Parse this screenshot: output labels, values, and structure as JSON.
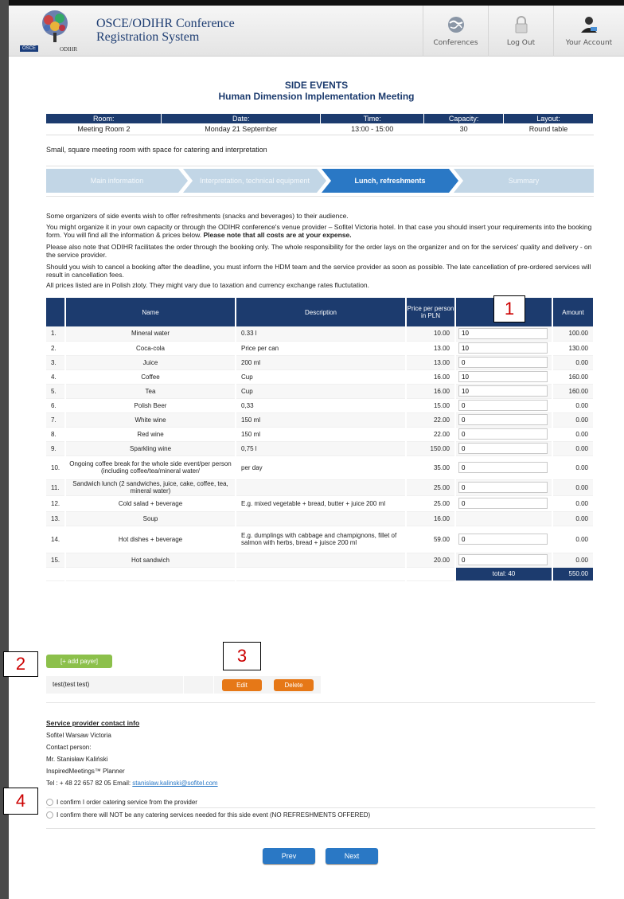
{
  "app": {
    "title_line1": "OSCE/ODIHR Conference",
    "title_line2": "Registration System",
    "logo_osce": "OSCE",
    "logo_odihr": "ODIHR"
  },
  "nav": [
    {
      "label": "Conferences",
      "icon": "globe-icon"
    },
    {
      "label": "Log Out",
      "icon": "lock-icon"
    },
    {
      "label": "Your Account",
      "icon": "user-icon"
    }
  ],
  "page": {
    "title": "SIDE EVENTS",
    "subtitle": "Human Dimension Implementation Meeting"
  },
  "info_table": {
    "headers": [
      "Room:",
      "Date:",
      "Time:",
      "Capacity:",
      "Layout:"
    ],
    "values": [
      "Meeting Room 2",
      "Monday 21 September",
      "13:00 - 15:00",
      "30",
      "Round table"
    ]
  },
  "room_description": "Small, square meeting room with space for catering and interpretation",
  "steps": [
    {
      "label": "Main information",
      "active": false
    },
    {
      "label": "Interpretation, technical equipment",
      "active": false
    },
    {
      "label": "Lunch, refreshments",
      "active": true
    },
    {
      "label": "Summary",
      "active": false
    }
  ],
  "intro": {
    "p1": "Some organizers of side events wish to offer refreshments (snacks and beverages) to their audience.",
    "p2": "You might organize it in your own capacity or through the ODIHR conference's venue provider – Sofitel Victoria hotel.  In that case you should insert your requirements into the booking form. You will find all the information & prices below.",
    "p2_bold": "Please note that all costs are at your expense.",
    "p3": "Please also note that ODIHR facilitates the order through the booking only. The whole responsibility for the order lays on the organizer and on for the services' quality and delivery - on the service provider.",
    "p4": "Should you wish to cancel a booking after the deadline, you must inform the HDM team and the service provider as soon as possible. The late cancellation of pre-ordered services will result in cancellation fees.",
    "p5": "All prices listed are in Polish zloty. They might vary due to taxation and currency exchange rates fluctutation."
  },
  "order_table": {
    "headers": {
      "num": "",
      "name": "Name",
      "desc": "Description",
      "price": "Price per person in PLN",
      "qty": "",
      "amount": "Amount"
    },
    "rows": [
      {
        "num": "1.",
        "name": "Mineral water",
        "desc": "0.33 l",
        "price": "10.00",
        "qty": "10",
        "amount": "100.00"
      },
      {
        "num": "2.",
        "name": "Coca-cola",
        "desc": "Price per can",
        "price": "13.00",
        "qty": "10",
        "amount": "130.00"
      },
      {
        "num": "3.",
        "name": "Juice",
        "desc": "200 ml",
        "price": "13.00",
        "qty": "0",
        "amount": "0.00"
      },
      {
        "num": "4.",
        "name": "Coffee",
        "desc": "Cup",
        "price": "16.00",
        "qty": "10",
        "amount": "160.00"
      },
      {
        "num": "5.",
        "name": "Tea",
        "desc": "Cup",
        "price": "16.00",
        "qty": "10",
        "amount": "160.00"
      },
      {
        "num": "6.",
        "name": "Polish Beer",
        "desc": "0,33",
        "price": "15.00",
        "qty": "0",
        "amount": "0.00"
      },
      {
        "num": "7.",
        "name": "White wine",
        "desc": "150 ml",
        "price": "22.00",
        "qty": "0",
        "amount": "0.00"
      },
      {
        "num": "8.",
        "name": "Red wine",
        "desc": "150 ml",
        "price": "22.00",
        "qty": "0",
        "amount": "0.00"
      },
      {
        "num": "9.",
        "name": "Sparkling wine",
        "desc": "0,75 l",
        "price": "150.00",
        "qty": "0",
        "amount": "0.00"
      },
      {
        "num": "10.",
        "name": "Ongoing coffee break for the whole side event/per person (including coffee/tea/mineral water/",
        "desc": "per day",
        "price": "35.00",
        "qty": "0",
        "amount": "0.00"
      },
      {
        "num": "11.",
        "name": "Sandwich lunch (2 sandwiches, juice, cake, coffee, tea, mineral water)",
        "desc": "",
        "price": "25.00",
        "qty": "0",
        "amount": "0.00"
      },
      {
        "num": "12.",
        "name": "Cold salad + beverage",
        "desc": "E.g. mixed vegetable + bread, butter + juice 200 ml",
        "price": "25.00",
        "qty": "0",
        "amount": "0.00"
      },
      {
        "num": "13.",
        "name": "Soup",
        "desc": "",
        "price": "16.00",
        "qty": "",
        "amount": "0.00"
      },
      {
        "num": "14.",
        "name": "Hot dishes + beverage",
        "desc": "E.g. dumplings with cabbage and champignons, fillet of salmon with herbs, bread + juisce 200 ml",
        "price": "59.00",
        "qty": "0",
        "amount": "0.00"
      },
      {
        "num": "15.",
        "name": "Hot sandwich",
        "desc": "",
        "price": "20.00",
        "qty": "0",
        "amount": "0.00"
      }
    ],
    "total_label": "total: 40",
    "total_amount": "550.00"
  },
  "payers": {
    "add_label": "[+ add payer]",
    "rows": [
      {
        "name": "test(test test)",
        "edit": "Edit",
        "delete": "Delete"
      }
    ]
  },
  "service_provider": {
    "title": "Service provider contact info",
    "lines": [
      "Sofitel Warsaw Victoria",
      "Contact person:",
      "Mr. Stanisław Kaliński",
      "InspiredMeetings™ Planner"
    ],
    "tel_prefix": "Tel : + 48 22 657 82 05 Email: ",
    "email": "stanislaw.kalinski@sofitel.com"
  },
  "confirm": {
    "option1": "I confirm I order catering service from the provider",
    "option2": "I confirm there will NOT be any catering services needed for this side event (NO REFRESHMENTS OFFERED)"
  },
  "buttons": {
    "prev": "Prev",
    "next": "Next"
  },
  "callouts": [
    "1",
    "2",
    "3",
    "4"
  ],
  "colors": {
    "primary": "#1c3b6e",
    "accent": "#2a78c5",
    "green": "#8cc04b",
    "orange": "#e67817",
    "callout_text": "#cc0000"
  }
}
